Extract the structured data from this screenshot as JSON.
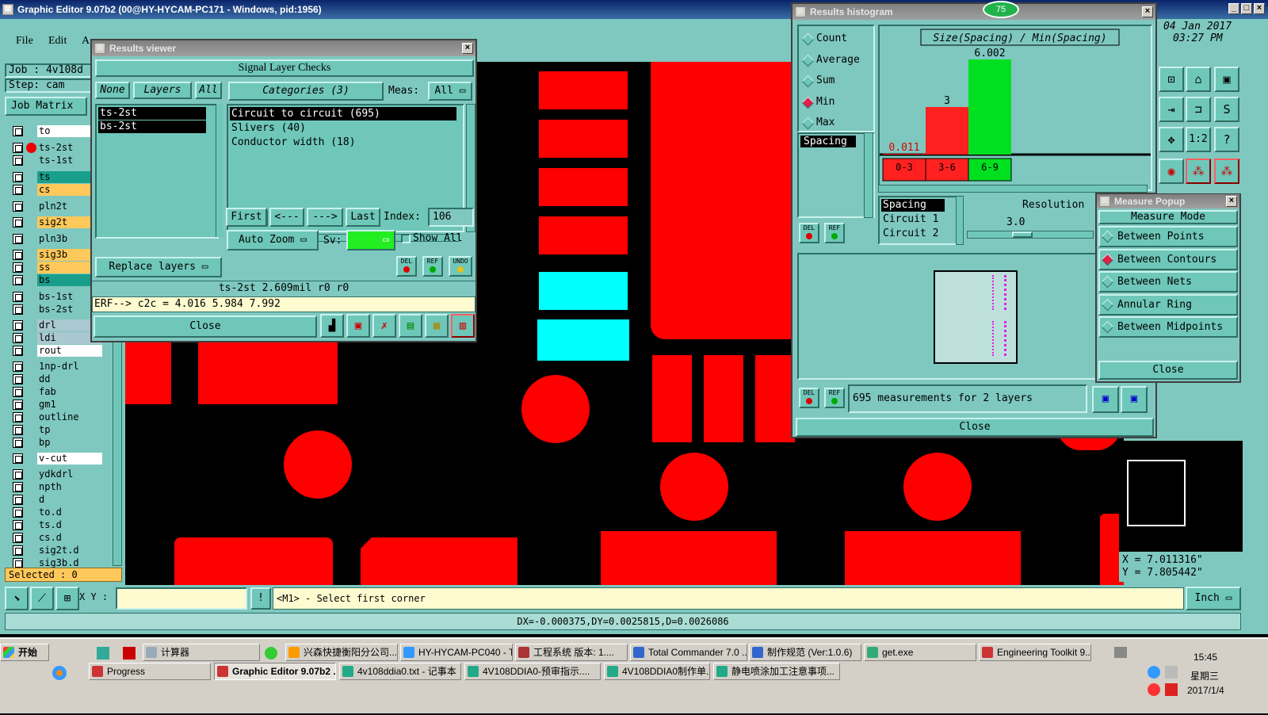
{
  "main_window": {
    "title": "Graphic Editor 9.07b2 (00@HY-HYCAM-PC171 - Windows, pid:1956)"
  },
  "menu": {
    "file": "File",
    "edit": "Edit",
    "action": "A"
  },
  "job_panel": {
    "job_label": "Job : 4v108d",
    "step_label": "Step: cam",
    "job_matrix": "Job Matrix",
    "selected": "Selected : 0"
  },
  "layers": [
    {
      "name": "to",
      "color": "#ffffff"
    },
    {
      "name": "ts-2st",
      "color": "#7ec8c0",
      "active": true
    },
    {
      "name": "ts-1st",
      "color": "#7ec8c0"
    },
    {
      "name": "ts",
      "color": "#1a9e8c"
    },
    {
      "name": "cs",
      "color": "#ffc85a"
    },
    {
      "name": "pln2t",
      "color": "#7ec8c0"
    },
    {
      "name": "sig2t",
      "color": "#ffc85a"
    },
    {
      "name": "pln3b",
      "color": "#7ec8c0"
    },
    {
      "name": "sig3b",
      "color": "#ffc85a"
    },
    {
      "name": "ss",
      "color": "#ffc85a"
    },
    {
      "name": "bs",
      "color": "#1a9e8c"
    },
    {
      "name": "bs-1st",
      "color": "#7ec8c0"
    },
    {
      "name": "bs-2st",
      "color": "#7ec8c0"
    },
    {
      "name": "drl",
      "color": "#a9c8d0"
    },
    {
      "name": "ldi",
      "color": "#a9c8d0"
    },
    {
      "name": "rout",
      "color": "#ffffff"
    },
    {
      "name": "1np-drl",
      "color": "#7ec8c0"
    },
    {
      "name": "dd",
      "color": "#7ec8c0"
    },
    {
      "name": "fab",
      "color": "#7ec8c0"
    },
    {
      "name": "gm1",
      "color": "#7ec8c0"
    },
    {
      "name": "outline",
      "color": "#7ec8c0"
    },
    {
      "name": "tp",
      "color": "#7ec8c0"
    },
    {
      "name": "bp",
      "color": "#7ec8c0"
    },
    {
      "name": "v-cut",
      "color": "#ffffff"
    },
    {
      "name": "ydkdrl",
      "color": "#7ec8c0"
    },
    {
      "name": "npth",
      "color": "#7ec8c0"
    },
    {
      "name": "d",
      "color": "#7ec8c0"
    },
    {
      "name": "to.d",
      "color": "#7ec8c0"
    },
    {
      "name": "ts.d",
      "color": "#7ec8c0"
    },
    {
      "name": "cs.d",
      "color": "#7ec8c0"
    },
    {
      "name": "sig2t.d",
      "color": "#7ec8c0"
    },
    {
      "name": "sig3b.d",
      "color": "#7ec8c0"
    }
  ],
  "results_viewer": {
    "title": "Results viewer",
    "header": "Signal Layer Checks",
    "none_btn": "None",
    "layers_btn": "Layers",
    "all_btn": "All",
    "categories_btn": "Categories (3)",
    "meas_label": "Meas:",
    "meas_value": "All",
    "layer_list": [
      "ts-2st",
      "bs-2st"
    ],
    "categories": [
      "Circuit to circuit (695)",
      "Slivers (40)",
      "Conductor width (18)"
    ],
    "first_btn": "First",
    "prev_btn": "<---",
    "next_btn": "--->",
    "last_btn": "Last",
    "index_label": "Index:",
    "index_value": "106",
    "auto_zoom": "Auto Zoom",
    "sv_label": "Sv:",
    "show_all": "Show All",
    "replace_layers": "Replace layers",
    "status_line": "ts-2st 2.609mil   r0  r0",
    "erf_line": "ERF--> c2c = 4.016 5.984 7.992",
    "close": "Close",
    "del": "DEL",
    "ref": "REF",
    "undo": "UNDO"
  },
  "histogram": {
    "title": "Results histogram",
    "badge": "75",
    "options": [
      "Count",
      "Average",
      "Sum",
      "Min",
      "Max"
    ],
    "selected_option": "Min",
    "field_selected": "Spacing",
    "chart_title": "Size(Spacing) / Min(Spacing)",
    "bars": [
      {
        "bin": "0-3",
        "value": 0.011,
        "label": "0.011",
        "color": "#ff2020"
      },
      {
        "bin": "3-6",
        "value": 3,
        "label": "3",
        "color": "#ff2020"
      },
      {
        "bin": "6-9",
        "value": 6.002,
        "label": "6.002",
        "color": "#00e020"
      }
    ],
    "ymax": 6.002,
    "field_list": [
      "Spacing",
      "Circuit 1",
      "Circuit 2"
    ],
    "resolution_label": "Resolution",
    "resolution_value": "3.0",
    "status": "695 measurements for 2 layers",
    "close": "Close",
    "del": "DEL",
    "ref": "REF"
  },
  "measure_popup": {
    "title": "Measure Popup",
    "header": "Measure Mode",
    "modes": [
      "Between Points",
      "Between Contours",
      "Between Nets",
      "Annular Ring",
      "Between Midpoints"
    ],
    "selected_mode": "Between Contours",
    "close": "Close"
  },
  "datetime": {
    "date": "04 Jan 2017",
    "time": "03:27 PM"
  },
  "coords": {
    "x": "X = 7.011316\"",
    "y": "Y = 7.805442\""
  },
  "bottom_bar": {
    "xy_label": "X Y :",
    "xy_value": "",
    "prompt": "<M1> - Select first corner",
    "units": "Inch",
    "delta": "DX=-0.000375,DY=0.0025815,D=0.0026086"
  },
  "right_toolbar": [
    "1:2"
  ],
  "taskbar": {
    "start": "开始",
    "row1": [
      "计算器",
      "兴森快捷衡阳分公司...",
      "HY-HYCAM-PC040 - T...",
      "工程系统  版本: 1....",
      "Total Commander 7.0 ...",
      "制作规范 (Ver:1.0.6)",
      "get.exe",
      "Engineering Toolkit 9...."
    ],
    "row2": [
      "Progress",
      "Graphic Editor 9.07b2 ...",
      "4v108ddia0.txt - 记事本",
      "4V108DDIA0-预审指示....",
      "4V108DDIA0制作单.xls  ...",
      "静电喷涂加工注意事项..."
    ],
    "clock": "15:45",
    "weekday": "星期三",
    "date": "2017/1/4"
  }
}
